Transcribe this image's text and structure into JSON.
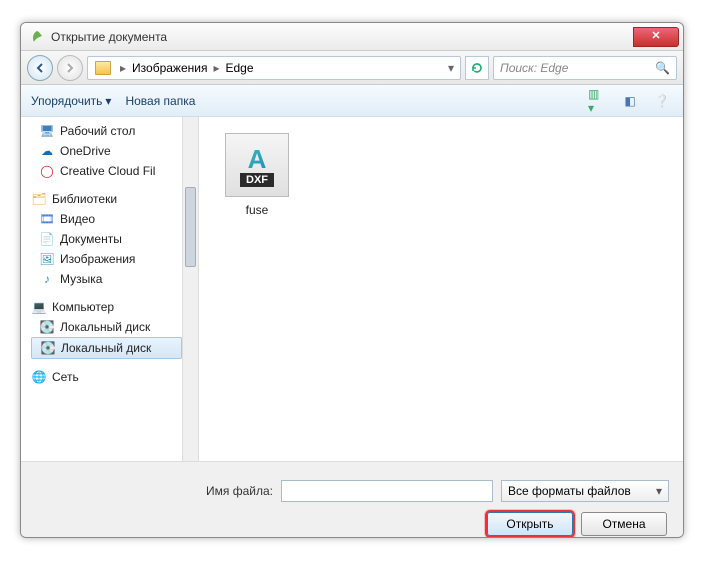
{
  "window": {
    "title": "Открытие документа"
  },
  "nav": {
    "breadcrumb": [
      "Изображения",
      "Edge"
    ],
    "search_placeholder": "Поиск: Edge"
  },
  "toolbar": {
    "organize": "Упорядочить",
    "newfolder": "Новая папка"
  },
  "tree": {
    "items": [
      {
        "icon": "desktop",
        "label": "Рабочий стол"
      },
      {
        "icon": "cloud",
        "label": "OneDrive"
      },
      {
        "icon": "cc",
        "label": "Creative Cloud Fil"
      }
    ],
    "libraries_label": "Библиотеки",
    "libraries": [
      {
        "icon": "video",
        "label": "Видео"
      },
      {
        "icon": "doc",
        "label": "Документы"
      },
      {
        "icon": "img",
        "label": "Изображения"
      },
      {
        "icon": "music",
        "label": "Музыка"
      }
    ],
    "computer_label": "Компьютер",
    "disks": [
      {
        "label": "Локальный диск"
      },
      {
        "label": "Локальный диск"
      }
    ],
    "network_label": "Сеть"
  },
  "files": [
    {
      "ext": "DXF",
      "name": "fuse"
    }
  ],
  "footer": {
    "filename_label": "Имя файла:",
    "filename_value": "",
    "filter": "Все форматы файлов",
    "open": "Открыть",
    "cancel": "Отмена"
  }
}
